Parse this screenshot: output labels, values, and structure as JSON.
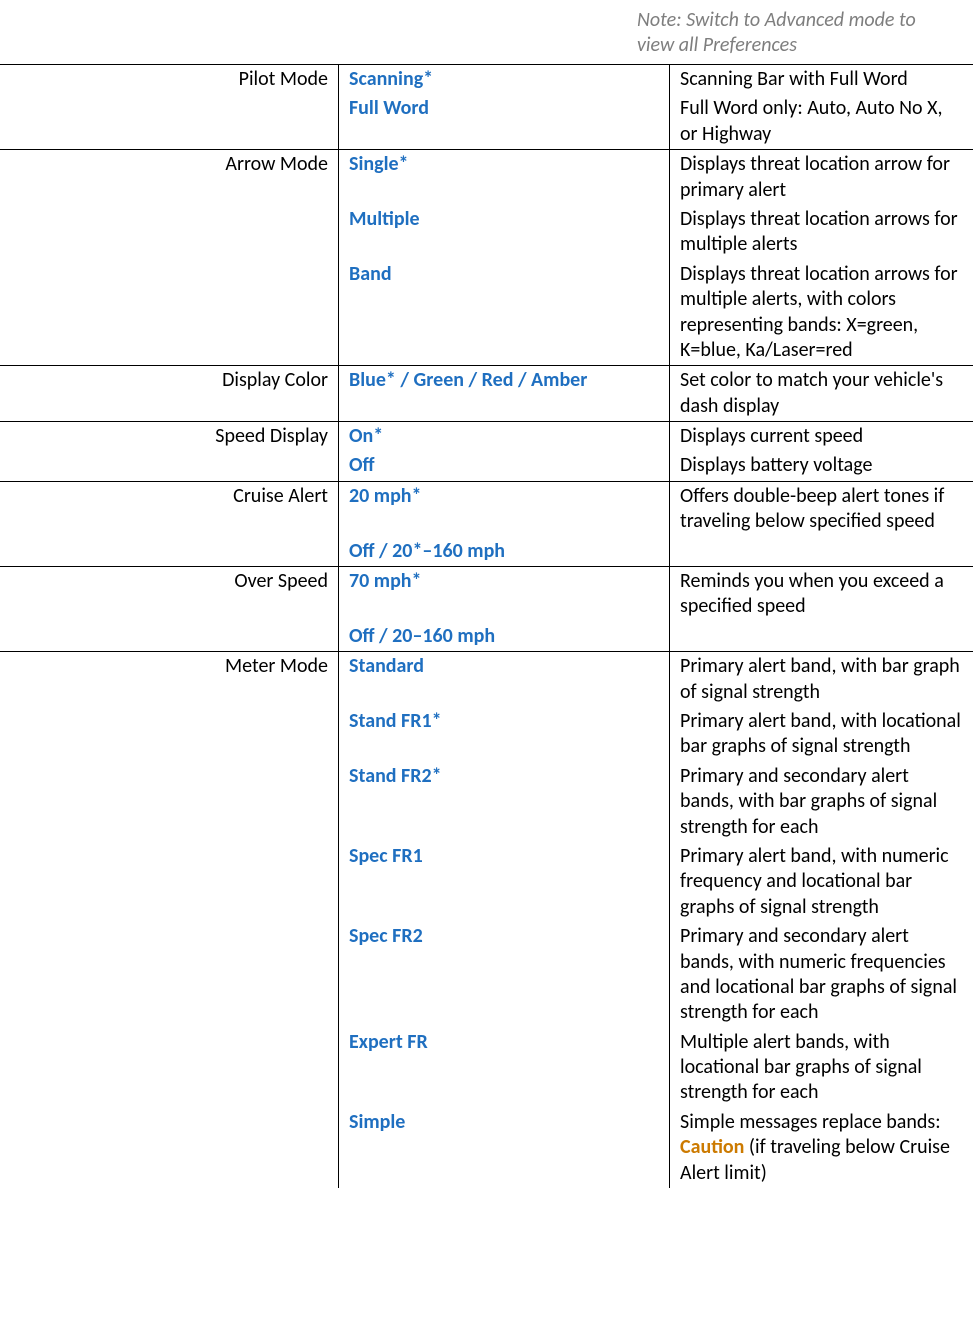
{
  "note": "Note: Switch to Advanced mode to view all Preferences",
  "rows": [
    {
      "label": "Pilot Mode",
      "options": [
        {
          "text": "Scanning*",
          "desc": "Scanning Bar with Full Word"
        },
        {
          "text": "Full Word",
          "desc": "Full Word only: Auto, Auto No X, or Highway"
        }
      ]
    },
    {
      "label": "Arrow Mode",
      "options": [
        {
          "text": "Single*",
          "desc": "Displays threat location arrow for primary alert"
        },
        {
          "text": "Multiple",
          "desc": "Displays threat location arrows for multiple alerts"
        },
        {
          "text": "Band",
          "desc": "Displays threat location arrows for multiple alerts, with colors representing bands: X=green, K=blue, Ka/Laser=red"
        }
      ]
    },
    {
      "label": "Display Color",
      "options": [
        {
          "text": "Blue* / Green / Red / Amber",
          "desc": "Set color to match your vehicle's dash display"
        }
      ]
    },
    {
      "label": "Speed Display",
      "options": [
        {
          "text": "On*",
          "desc": "Displays current speed"
        },
        {
          "text": "Off",
          "desc": "Displays battery voltage"
        }
      ]
    },
    {
      "label": "Cruise Alert",
      "options": [
        {
          "text": "20 mph*",
          "desc": "Offers double-beep alert tones if traveling below specified speed"
        },
        {
          "text": "Off / 20*–160 mph",
          "desc": ""
        }
      ]
    },
    {
      "label": "Over Speed",
      "options": [
        {
          "text": "70 mph*",
          "desc": "Reminds you when you exceed a specified speed"
        },
        {
          "text": "Off / 20–160 mph",
          "desc": ""
        }
      ]
    },
    {
      "label": "Meter Mode",
      "options": [
        {
          "text": "Standard",
          "desc": "Primary alert band, with bar graph of signal strength"
        },
        {
          "text": "Stand FR1*",
          "desc": "Primary alert band, with locational bar graphs of signal strength"
        },
        {
          "text": "Stand FR2*",
          "desc": "Primary and secondary alert bands, with bar graphs of signal strength for each"
        },
        {
          "text": "Spec FR1",
          "desc": "Primary alert band, with numeric frequency and locational bar graphs of signal strength"
        },
        {
          "text": "Spec FR2",
          "desc": "Primary and secondary alert bands, with numeric frequencies and locational bar graphs of signal strength for each"
        },
        {
          "text": "Expert FR",
          "desc": "Multiple alert bands, with locational bar graphs of signal strength for each"
        },
        {
          "text": "Simple",
          "descParts": [
            {
              "text": "Simple messages replace bands: "
            },
            {
              "text": "Caution",
              "class": "caution"
            },
            {
              "text": " (if traveling below Cruise Alert limit)"
            }
          ]
        }
      ]
    }
  ]
}
